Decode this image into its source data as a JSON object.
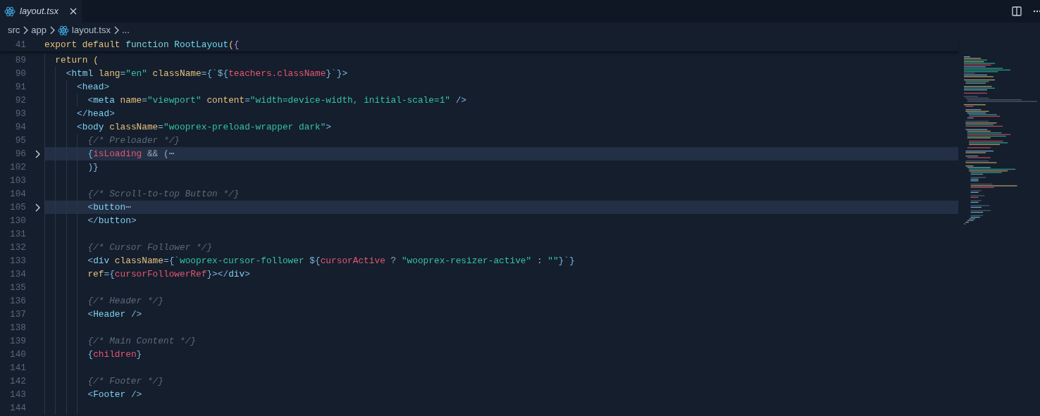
{
  "tab": {
    "title": "layout.tsx",
    "preview": true
  },
  "breadcrumb": [
    "src",
    "app",
    "layout.tsx",
    "..."
  ],
  "sticky_line": {
    "number": "41",
    "tokens": [
      {
        "kind": "kw",
        "t": "export default "
      },
      {
        "kind": "fn",
        "t": "function "
      },
      {
        "kind": "name",
        "t": "RootLayout"
      },
      {
        "kind": "kw",
        "t": "("
      },
      {
        "kind": "brace",
        "t": "{"
      }
    ]
  },
  "lines": [
    {
      "number": "89",
      "folded": false,
      "tokens": [
        {
          "kind": "kw",
          "t": "return "
        },
        {
          "kind": "kw",
          "t": "("
        }
      ],
      "children": [
        {
          "number": "90",
          "folded": false,
          "tokens": [
            {
              "kind": "punct",
              "t": "<"
            },
            {
              "kind": "tag",
              "t": "html"
            },
            {
              "kind": "attr",
              "t": " lang"
            },
            {
              "kind": "punct",
              "t": "="
            },
            {
              "kind": "str",
              "t": "\"en\""
            },
            {
              "kind": "attr",
              "t": " className"
            },
            {
              "kind": "punct",
              "t": "={"
            },
            {
              "kind": "str",
              "t": "`"
            },
            {
              "kind": "punct",
              "t": "${"
            },
            {
              "kind": "var",
              "t": "teachers.className"
            },
            {
              "kind": "punct",
              "t": "}"
            },
            {
              "kind": "str",
              "t": "`"
            },
            {
              "kind": "punct",
              "t": "}>"
            }
          ],
          "children": [
            {
              "number": "91",
              "folded": false,
              "tokens": [
                {
                  "kind": "punct",
                  "t": "<"
                },
                {
                  "kind": "tag",
                  "t": "head"
                },
                {
                  "kind": "punct",
                  "t": ">"
                }
              ],
              "children": [
                {
                  "number": "92",
                  "folded": false,
                  "tokens": [
                    {
                      "kind": "punct",
                      "t": "<"
                    },
                    {
                      "kind": "tag",
                      "t": "meta"
                    },
                    {
                      "kind": "attr",
                      "t": " name"
                    },
                    {
                      "kind": "punct",
                      "t": "="
                    },
                    {
                      "kind": "str",
                      "t": "\"viewport\""
                    },
                    {
                      "kind": "attr",
                      "t": " content"
                    },
                    {
                      "kind": "punct",
                      "t": "="
                    },
                    {
                      "kind": "str",
                      "t": "\"width=device-width, initial-scale=1\""
                    },
                    {
                      "kind": "punct",
                      "t": " />"
                    }
                  ]
                }
              ]
            },
            {
              "number": "93",
              "folded": false,
              "tokens": [
                {
                  "kind": "punct",
                  "t": "</"
                },
                {
                  "kind": "tag",
                  "t": "head"
                },
                {
                  "kind": "punct",
                  "t": ">"
                }
              ]
            },
            {
              "number": "94",
              "folded": false,
              "tokens": [
                {
                  "kind": "punct",
                  "t": "<"
                },
                {
                  "kind": "tag",
                  "t": "body"
                },
                {
                  "kind": "attr",
                  "t": " className"
                },
                {
                  "kind": "punct",
                  "t": "="
                },
                {
                  "kind": "str",
                  "t": "\"wooprex-preload-wrapper dark\""
                },
                {
                  "kind": "punct",
                  "t": ">"
                }
              ],
              "children": [
                {
                  "number": "95",
                  "folded": false,
                  "tokens": [
                    {
                      "kind": "comment",
                      "t": "{/* Preloader */}"
                    }
                  ]
                },
                {
                  "number": "96",
                  "folded": true,
                  "tokens": [
                    {
                      "kind": "punct",
                      "t": "{"
                    },
                    {
                      "kind": "var",
                      "t": "isLoading"
                    },
                    {
                      "kind": "op",
                      "t": " && "
                    },
                    {
                      "kind": "punct",
                      "t": "("
                    },
                    {
                      "kind": "op",
                      "t": "⋯"
                    }
                  ]
                },
                {
                  "number": "102",
                  "folded": false,
                  "tokens": [
                    {
                      "kind": "punct",
                      "t": ")}"
                    }
                  ]
                },
                {
                  "number": "103",
                  "folded": false
                },
                {
                  "number": "104",
                  "folded": false,
                  "tokens": [
                    {
                      "kind": "comment",
                      "t": "{/* Scroll-to-top Button */}"
                    }
                  ]
                },
                {
                  "number": "105",
                  "folded": true,
                  "tokens": [
                    {
                      "kind": "punct",
                      "t": "<"
                    },
                    {
                      "kind": "tag",
                      "t": "button"
                    },
                    {
                      "kind": "op",
                      "t": "⋯"
                    }
                  ]
                },
                {
                  "number": "130",
                  "folded": false,
                  "tokens": [
                    {
                      "kind": "punct",
                      "t": "</"
                    },
                    {
                      "kind": "tag",
                      "t": "button"
                    },
                    {
                      "kind": "punct",
                      "t": ">"
                    }
                  ]
                },
                {
                  "number": "131",
                  "folded": false
                },
                {
                  "number": "132",
                  "folded": false,
                  "tokens": [
                    {
                      "kind": "comment",
                      "t": "{/* Cursor Follower */}"
                    }
                  ]
                },
                {
                  "number": "133",
                  "folded": false,
                  "tokens": [
                    {
                      "kind": "punct",
                      "t": "<"
                    },
                    {
                      "kind": "tag",
                      "t": "div"
                    },
                    {
                      "kind": "attr",
                      "t": " className"
                    },
                    {
                      "kind": "punct",
                      "t": "={"
                    },
                    {
                      "kind": "str",
                      "t": "`wooprex-cursor-follower "
                    },
                    {
                      "kind": "punct",
                      "t": "${"
                    },
                    {
                      "kind": "var",
                      "t": "cursorActive"
                    },
                    {
                      "kind": "op",
                      "t": " ? "
                    },
                    {
                      "kind": "str",
                      "t": "\"wooprex-resizer-active\""
                    },
                    {
                      "kind": "op",
                      "t": " : "
                    },
                    {
                      "kind": "str",
                      "t": "\"\""
                    },
                    {
                      "kind": "punct",
                      "t": "}"
                    },
                    {
                      "kind": "str",
                      "t": "`"
                    },
                    {
                      "kind": "punct",
                      "t": "}"
                    }
                  ]
                },
                {
                  "number": "134",
                  "folded": false,
                  "tokens": [
                    {
                      "kind": "attr",
                      "t": "ref"
                    },
                    {
                      "kind": "punct",
                      "t": "={"
                    },
                    {
                      "kind": "var",
                      "t": "cursorFollowerRef"
                    },
                    {
                      "kind": "punct",
                      "t": "}></"
                    },
                    {
                      "kind": "tag",
                      "t": "div"
                    },
                    {
                      "kind": "punct",
                      "t": ">"
                    }
                  ]
                },
                {
                  "number": "135",
                  "folded": false
                },
                {
                  "number": "136",
                  "folded": false,
                  "tokens": [
                    {
                      "kind": "comment",
                      "t": "{/* Header */}"
                    }
                  ]
                },
                {
                  "number": "137",
                  "folded": false,
                  "tokens": [
                    {
                      "kind": "punct",
                      "t": "<"
                    },
                    {
                      "kind": "tag",
                      "t": "Header"
                    },
                    {
                      "kind": "punct",
                      "t": " />"
                    }
                  ]
                },
                {
                  "number": "138",
                  "folded": false
                },
                {
                  "number": "139",
                  "folded": false,
                  "tokens": [
                    {
                      "kind": "comment",
                      "t": "{/* Main Content */}"
                    }
                  ]
                },
                {
                  "number": "140",
                  "folded": false,
                  "tokens": [
                    {
                      "kind": "punct",
                      "t": "{"
                    },
                    {
                      "kind": "var",
                      "t": "children"
                    },
                    {
                      "kind": "punct",
                      "t": "}"
                    }
                  ]
                },
                {
                  "number": "141",
                  "folded": false
                },
                {
                  "number": "142",
                  "folded": false,
                  "tokens": [
                    {
                      "kind": "comment",
                      "t": "{/* Footer */}"
                    }
                  ]
                },
                {
                  "number": "143",
                  "folded": false,
                  "tokens": [
                    {
                      "kind": "punct",
                      "t": "<"
                    },
                    {
                      "kind": "tag",
                      "t": "Footer"
                    },
                    {
                      "kind": "punct",
                      "t": " />"
                    }
                  ]
                },
                {
                  "number": "144",
                  "folded": false
                }
              ]
            }
          ]
        }
      ]
    }
  ]
}
